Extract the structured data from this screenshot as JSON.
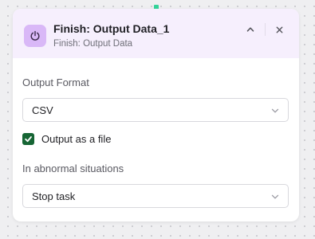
{
  "node": {
    "title": "Finish: Output Data_1",
    "subtitle": "Finish: Output Data",
    "icon": "power-icon",
    "accent_color": "#d9b8f7",
    "header_bg": "#f6effd"
  },
  "header_actions": {
    "collapse_icon": "chevron-up-icon",
    "close_icon": "close-icon"
  },
  "output_format": {
    "label": "Output Format",
    "selected": "CSV"
  },
  "output_as_file": {
    "label": "Output as a file",
    "checked": true,
    "check_color": "#166534"
  },
  "abnormal": {
    "label": "In abnormal situations",
    "selected": "Stop task"
  }
}
